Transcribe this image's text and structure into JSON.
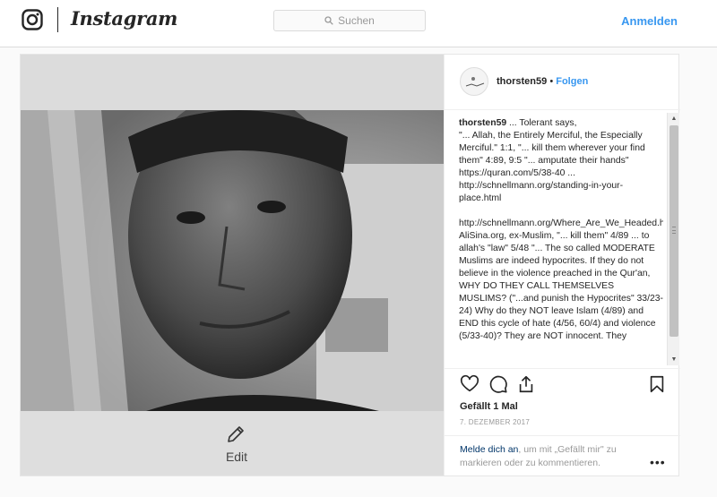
{
  "header": {
    "brand": "Instagram",
    "search_placeholder": "Suchen",
    "login_label": "Anmelden"
  },
  "media": {
    "edit_label": "Edit"
  },
  "post": {
    "username": "thorsten59",
    "separator": "•",
    "follow_label": "Folgen",
    "caption_user": "thorsten59",
    "caption_text": " ... Tolerant says,\n\"... Allah, the Entirely Merciful, the Especially Merciful.\" 1:1, \"... kill them wherever your find them\" 4:89, 9:5 \"... amputate their hands\" https://quran.com/5/38-40 ... http://schnellmann.org/standing-in-your-place.html\n\nhttp://schnellmann.org/Where_Are_We_Headed.html AliSina.org, ex-Muslim, \"... kill them\" 4/89 ... to allah's \"law\" 5/48 \"... The so called MODERATE Muslims are indeed hypocrites. If they do not believe in the violence preached in the Qur'an, WHY DO THEY CALL THEMSELVES MUSLIMS? (\"...and punish the Hypocrites\" 33/23-24) Why do they NOT leave Islam (4/89) and END this cycle of hate (4/56, 60/4) and violence (5/33-40)? They are NOT innocent. They",
    "likes": "Gefällt 1 Mal",
    "date": "7. DEZEMBER 2017",
    "prompt_link": "Melde dich an",
    "prompt_rest": ", um mit „Gefällt mir\" zu markieren oder zu kommentieren.",
    "more": "•••"
  },
  "icons": {
    "logo": "instagram-glyph-icon",
    "search": "search-icon",
    "edit": "pencil-icon",
    "like": "heart-icon",
    "comment": "comment-icon",
    "share": "share-icon",
    "save": "bookmark-icon",
    "scroll_up": "▲",
    "scroll_down": "▼"
  },
  "colors": {
    "link_blue": "#3897f0",
    "prompt_link": "#003569",
    "border": "#dbdbdb"
  }
}
